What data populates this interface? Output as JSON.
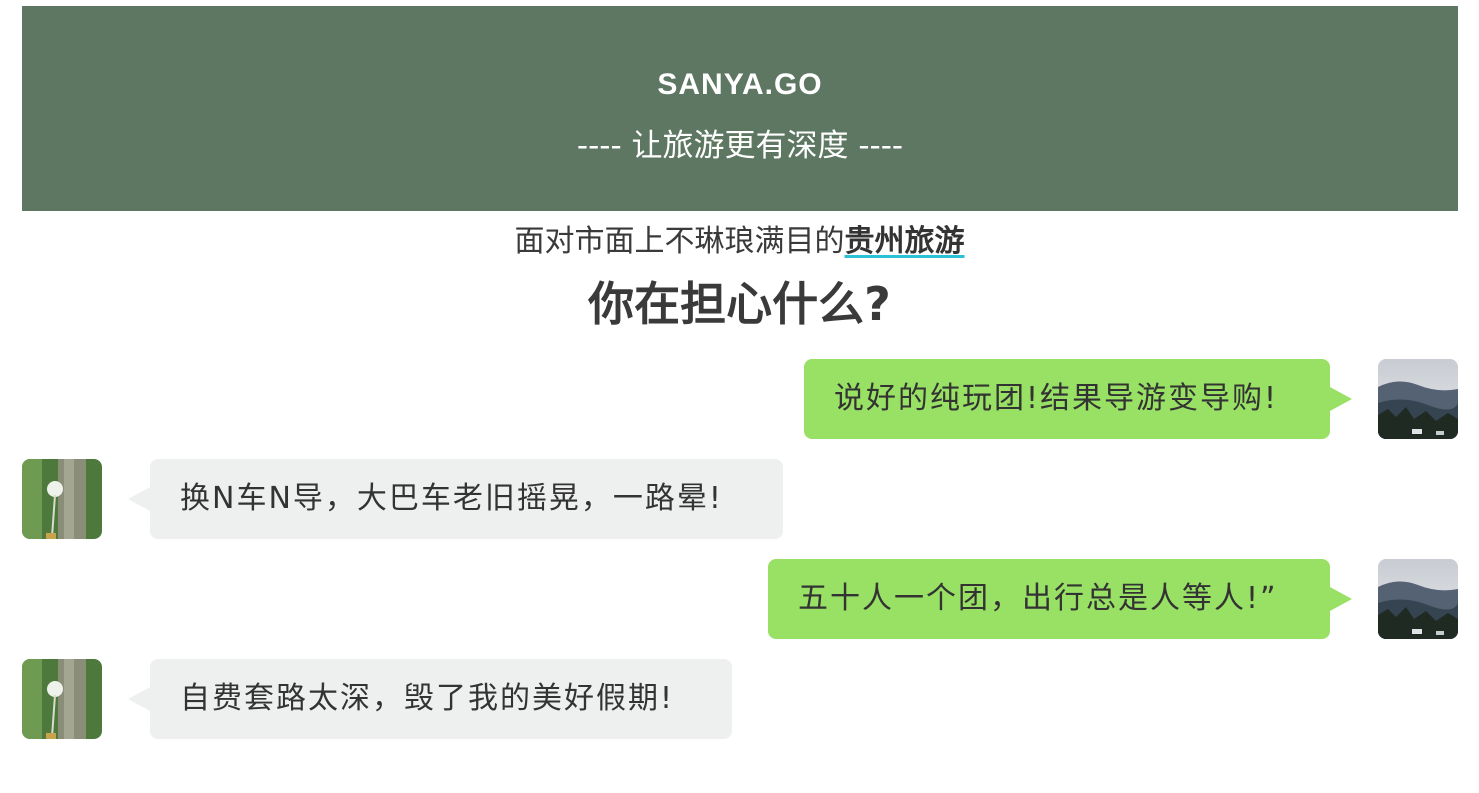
{
  "hero": {
    "brand": "SANYA.GO",
    "slogan": "---- 让旅游更有深度 ----",
    "background": "#5e7762"
  },
  "intro": {
    "line_prefix": "面对市面上不琳琅满目的",
    "line_highlight": "贵州旅游",
    "title": "你在担心什么?"
  },
  "messages": [
    {
      "side": "right",
      "text": "说好的纯玩团!结果导游变导购!",
      "avatar": "mountain-avatar"
    },
    {
      "side": "left",
      "text": "换N车N导，大巴车老旧摇晃，一路晕!",
      "avatar": "dandelion-avatar"
    },
    {
      "side": "right",
      "text": "五十人一个团，出行总是人等人!”",
      "avatar": "mountain-avatar"
    },
    {
      "side": "left",
      "text": "自费套路太深，毁了我的美好假期!",
      "avatar": "dandelion-avatar"
    }
  ],
  "colors": {
    "right_bubble": "#98e165",
    "left_bubble": "#eef0ef",
    "highlight_underline": "#2cc2d6"
  }
}
